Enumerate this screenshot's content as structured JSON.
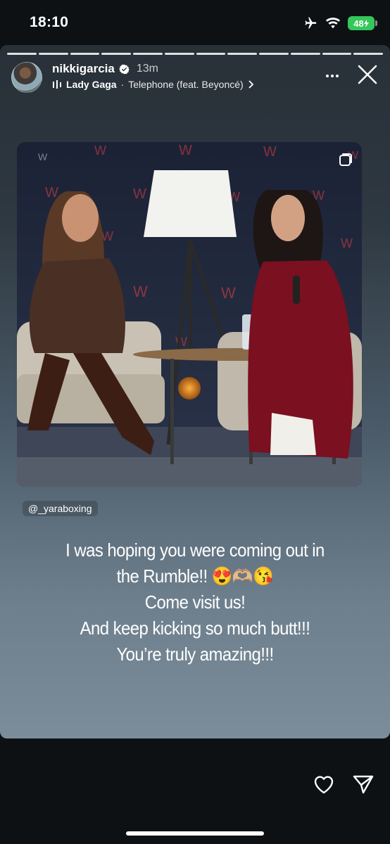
{
  "status_bar": {
    "time": "18:10",
    "battery": "48"
  },
  "story": {
    "segments": 12,
    "user": {
      "username": "nikkigarcia",
      "time_ago": "13m"
    },
    "music": {
      "artist": "Lady Gaga",
      "separator": "·",
      "track": "Telephone (feat. Beyoncé)"
    },
    "mention": "@_yaraboxing",
    "caption_lines": [
      "I was hoping you were coming out in",
      "the Rumble!! 😍🫶🏼😘",
      "Come visit us!",
      "And keep kicking so much butt!!!",
      "You’re truly amazing!!!"
    ]
  },
  "icons": {
    "airplane": "airplane-icon",
    "wifi": "wifi-icon",
    "verified": "verified-badge-icon",
    "music": "music-bars-icon",
    "chevron": "chevron-right-icon",
    "more": "more-icon",
    "close": "close-icon",
    "like": "heart-icon",
    "send": "send-icon",
    "repost": "repost-icon"
  },
  "colors": {
    "battery": "#34c759",
    "background": "#0d1114",
    "verified": "#ffffff"
  }
}
